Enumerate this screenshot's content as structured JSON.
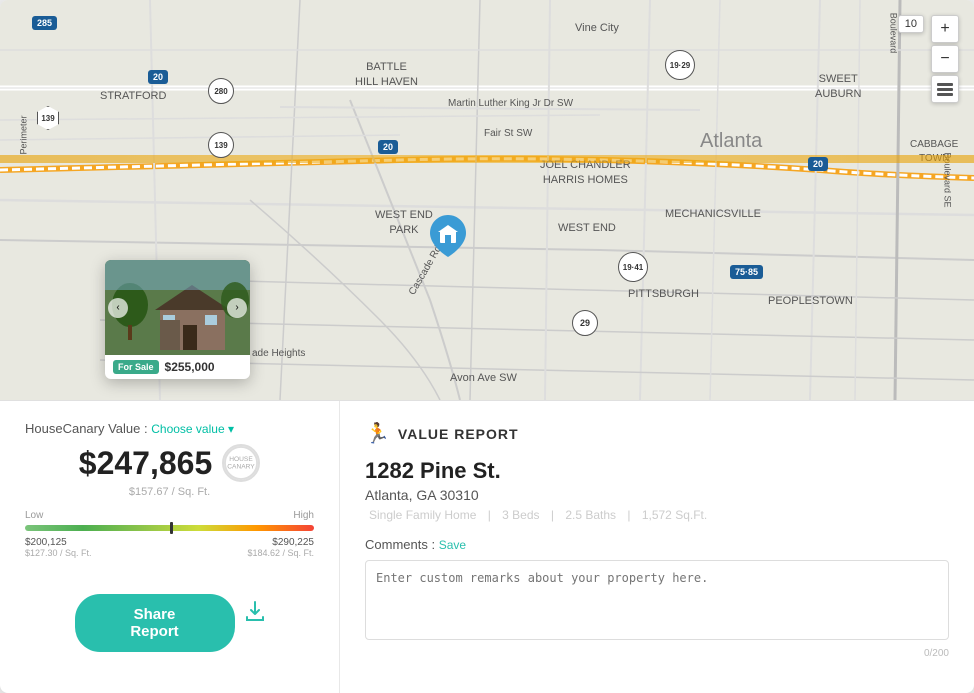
{
  "app": {
    "title": "HouseCanary Value Report"
  },
  "map": {
    "zoom_level": "10",
    "city_label": "Atlanta",
    "neighborhoods": [
      {
        "name": "STRATFORD",
        "top": "95",
        "left": "120"
      },
      {
        "name": "BATTLE\nHILL HAVEN",
        "top": "65",
        "left": "370"
      },
      {
        "name": "Vine City",
        "top": "25",
        "left": "590"
      },
      {
        "name": "SWEET\nAUBURN",
        "top": "75",
        "left": "830"
      },
      {
        "name": "CABBAGE\nTOWN",
        "top": "140",
        "left": "930"
      },
      {
        "name": "JOEL CHANDLER\nHARRIS HOMES",
        "top": "165",
        "left": "570"
      },
      {
        "name": "WEST END\nPARK",
        "top": "210",
        "left": "400"
      },
      {
        "name": "WEST END",
        "top": "225",
        "left": "580"
      },
      {
        "name": "MECHANICSVILLE",
        "top": "210",
        "left": "700"
      },
      {
        "name": "PITTSBURGH",
        "top": "290",
        "left": "650"
      },
      {
        "name": "PEOPLESTOWN",
        "top": "295",
        "left": "790"
      },
      {
        "name": "Cascade Heights",
        "top": "345",
        "left": "295"
      },
      {
        "name": "Avon Ave SW",
        "top": "370",
        "left": "490"
      },
      {
        "name": "Martin Luther King Jr Dr SW",
        "top": "100",
        "left": "530"
      },
      {
        "name": "Fair St SW",
        "top": "130",
        "left": "510"
      },
      {
        "name": "Cascade Rd",
        "top": "270",
        "left": "420"
      },
      {
        "name": "Perimeter",
        "top": "160",
        "left": "12"
      },
      {
        "name": "Boulevard SE",
        "top": "200",
        "left": "920"
      },
      {
        "name": "Boulevard",
        "top": "30",
        "left": "880"
      }
    ],
    "shields": [
      {
        "id": "285-top",
        "type": "interstate",
        "number": "285",
        "top": "22",
        "left": "40"
      },
      {
        "id": "20-left",
        "type": "interstate",
        "number": "20",
        "top": "75",
        "left": "155"
      },
      {
        "id": "280",
        "type": "us",
        "number": "280",
        "top": "80",
        "left": "215"
      },
      {
        "id": "139-top",
        "type": "state",
        "number": "139",
        "top": "110",
        "left": "40"
      },
      {
        "id": "139-mid",
        "type": "us",
        "number": "139",
        "top": "135",
        "left": "215"
      },
      {
        "id": "20-mid",
        "type": "interstate",
        "number": "20",
        "top": "145",
        "left": "385"
      },
      {
        "id": "19-29",
        "type": "us",
        "number": "19·29",
        "top": "55",
        "left": "672"
      },
      {
        "id": "20-right",
        "type": "interstate",
        "number": "20",
        "top": "160",
        "left": "815"
      },
      {
        "id": "19-41",
        "type": "us",
        "number": "19·41",
        "top": "255",
        "left": "625"
      },
      {
        "id": "75-85",
        "type": "interstate",
        "number": "75·85",
        "top": "270",
        "left": "740"
      },
      {
        "id": "29",
        "type": "us",
        "number": "29",
        "top": "315",
        "left": "580"
      }
    ],
    "zoom_btn_plus": "+",
    "zoom_btn_minus": "−",
    "zoom_value": "10"
  },
  "property_card": {
    "badge": "For Sale",
    "price": "$255,000"
  },
  "left_panel": {
    "housecanary_label": "HouseCanary Value :",
    "choose_value_label": "Choose value ▾",
    "main_value": "$247,865",
    "sqft_value": "$157.67 / Sq. Ft.",
    "hc_logo_text": "HC",
    "range_low_label": "Low",
    "range_high_label": "High",
    "range_low_value": "$200,125",
    "range_low_sqft": "$127.30 / Sq. Ft.",
    "range_high_value": "$290,225",
    "range_high_sqft": "$184.62 / Sq. Ft.",
    "share_btn_label": "Share Report"
  },
  "right_panel": {
    "report_icon": "🏃",
    "report_title": "VALUE REPORT",
    "address": "1282 Pine St.",
    "city_state_zip": "Atlanta, GA 30310",
    "property_type": "Single Family Home",
    "beds": "3 Beds",
    "baths": "2.5 Baths",
    "sqft": "1,572 Sq.Ft.",
    "comments_label": "Comments :",
    "save_label": "Save",
    "textarea_placeholder": "Enter custom remarks about your property here.",
    "char_count": "0/200"
  }
}
